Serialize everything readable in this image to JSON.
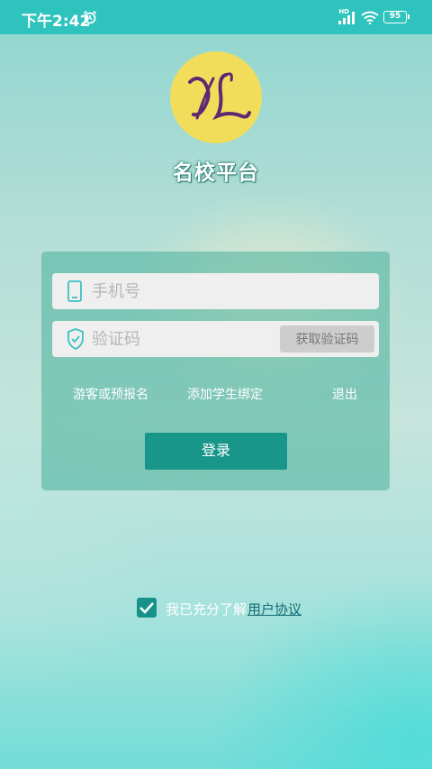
{
  "status_bar": {
    "time": "下午2:42",
    "network_label": "HD",
    "battery": "95"
  },
  "app": {
    "logo_text": "XL",
    "title": "名校平台"
  },
  "login": {
    "phone_placeholder": "手机号",
    "code_placeholder": "验证码",
    "get_code_label": "获取验证码",
    "guest_link": "游客或预报名",
    "bind_link": "添加学生绑定",
    "exit_link": "退出",
    "login_button": "登录"
  },
  "agreement": {
    "checked": true,
    "prefix": "我已充分了解",
    "link": "用户协议"
  },
  "colors": {
    "status_bar": "#2ec3bd",
    "accent": "#19968a",
    "logo_bg": "#f2dd5b"
  }
}
